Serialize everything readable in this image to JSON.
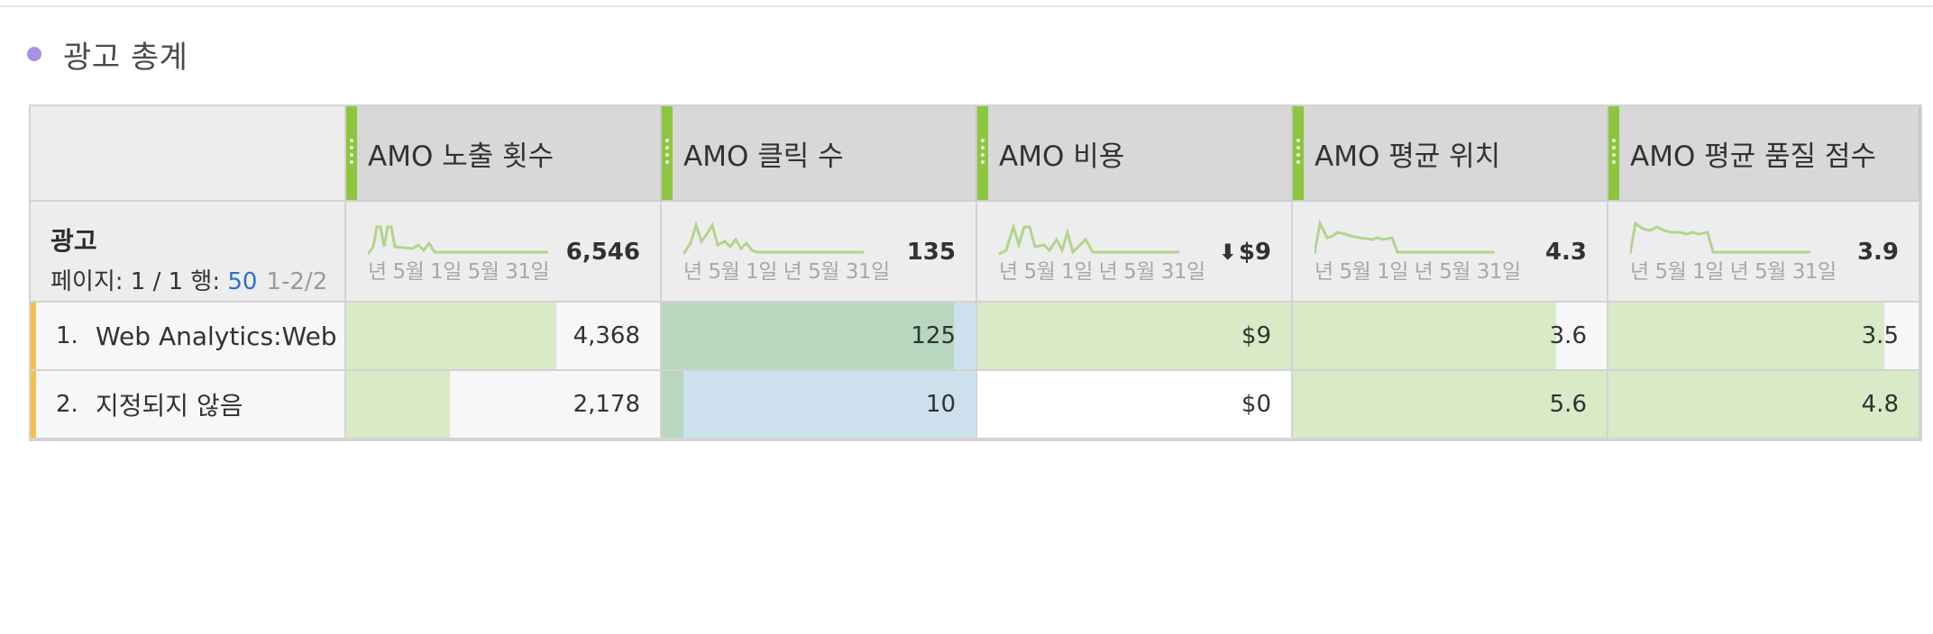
{
  "panel": {
    "title": "광고 총계",
    "dot_color": "#a692e0"
  },
  "table": {
    "dimension": {
      "name": "광고",
      "page_label": "페이지: 1 / 1 행: ",
      "rows_per_page": "50",
      "range": "1-2/2"
    },
    "columns": [
      {
        "label": "AMO 노출 횟수",
        "total": "6,546",
        "trend": "down",
        "axis_start": "년 5월 1일",
        "axis_end": "5월 31일"
      },
      {
        "label": "AMO 클릭 수",
        "total": "135",
        "trend": "down",
        "axis_start": "년 5월 1일",
        "axis_end": "년 5월 31일"
      },
      {
        "label": "AMO 비용",
        "total": "$9",
        "trend": "down",
        "show_arrow": true,
        "axis_start": "년 5월 1일",
        "axis_end": "년 5월 31일"
      },
      {
        "label": "AMO 평균 위치",
        "total": "4.3",
        "trend": "down",
        "axis_start": "년 5월 1일",
        "axis_end": "년 5월 31일"
      },
      {
        "label": "AMO 평균 품질 점수",
        "total": "3.9",
        "trend": "down",
        "axis_start": "년 5월 1일",
        "axis_end": "년 5월 31일"
      }
    ],
    "rows": [
      {
        "num": "1.",
        "label": "Web Analytics:Web…",
        "values": [
          "4,368",
          "125",
          "$9",
          "3.6",
          "3.5"
        ],
        "fractions": [
          0.67,
          0.93,
          1.0,
          0.84,
          0.89
        ]
      },
      {
        "num": "2.",
        "label": "지정되지 않음",
        "values": [
          "2,178",
          "10",
          "$0",
          "5.6",
          "4.8"
        ],
        "fractions": [
          0.33,
          0.07,
          0.0,
          1.0,
          1.0
        ]
      }
    ]
  },
  "colors": {
    "accent_green": "#8cc63f",
    "bar_green": "#d8eac6",
    "bar_green_selected": "#b7d8bf",
    "bar_blue": "#cce0ee",
    "row_marker": "#f4c04b",
    "link_blue": "#2d6fcf"
  }
}
